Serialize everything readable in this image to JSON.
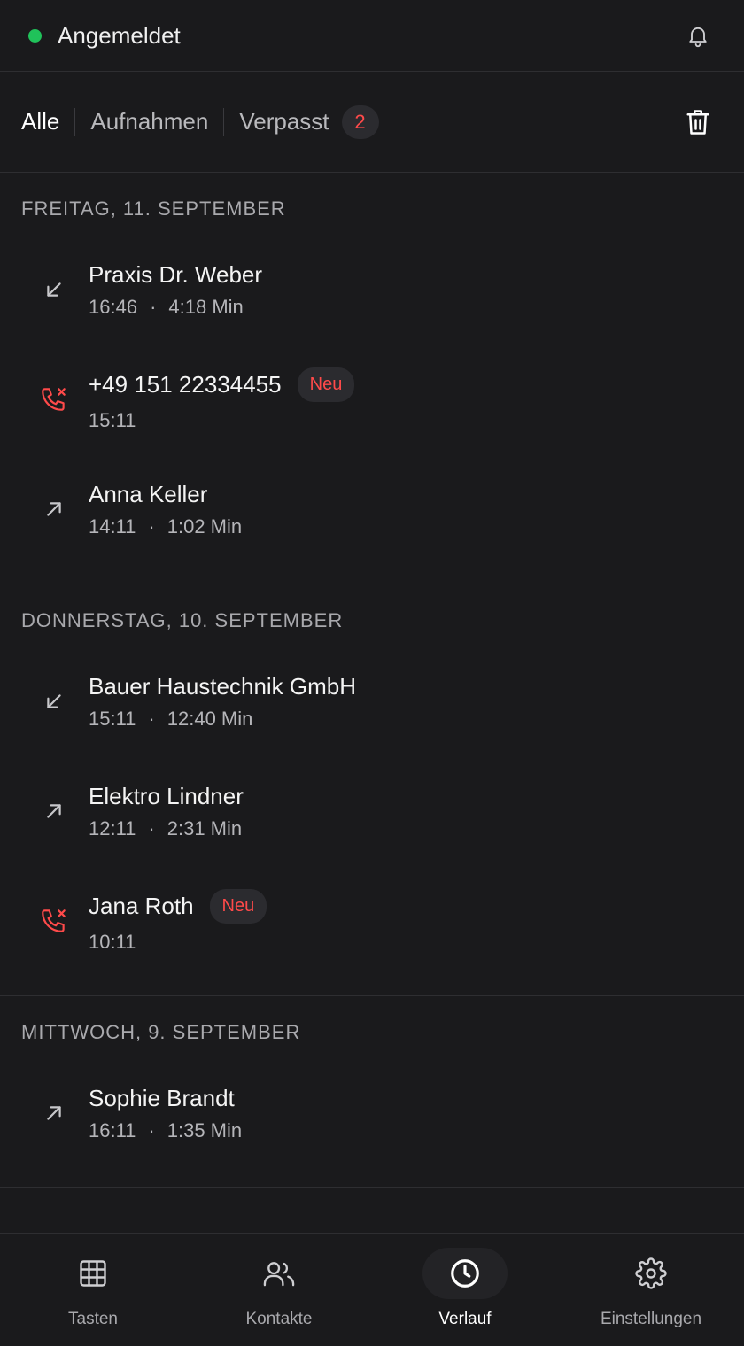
{
  "status": {
    "label": "Angemeldet",
    "dot_color": "#20c25a",
    "bell_icon": "bell-icon"
  },
  "tabs": {
    "items": [
      {
        "label": "Alle",
        "active": true
      },
      {
        "label": "Aufnahmen",
        "active": false
      },
      {
        "label": "Verpasst",
        "active": false
      }
    ],
    "missed_count": "2",
    "trash_icon": "trash-icon"
  },
  "sections": [
    {
      "title": "FREITAG, 11. SEPTEMBER",
      "calls": [
        {
          "type": "incoming",
          "name": "Praxis Dr. Weber",
          "time": "16:46",
          "separator": "·",
          "duration": "4:18 Min"
        },
        {
          "type": "missed",
          "name": "+49 151 22334455",
          "badge": "Neu",
          "time": "15:11"
        },
        {
          "type": "outgoing",
          "name": "Anna Keller",
          "time": "14:11",
          "separator": "·",
          "duration": "1:02 Min"
        }
      ]
    },
    {
      "title": "DONNERSTAG, 10. SEPTEMBER",
      "calls": [
        {
          "type": "incoming",
          "name": "Bauer Haustechnik GmbH",
          "time": "15:11",
          "separator": "·",
          "duration": "12:40 Min"
        },
        {
          "type": "outgoing",
          "name": "Elektro Lindner",
          "time": "12:11",
          "separator": "·",
          "duration": "2:31 Min"
        },
        {
          "type": "missed",
          "name": "Jana Roth",
          "badge": "Neu",
          "time": "10:11"
        }
      ]
    },
    {
      "title": "MITTWOCH, 9. SEPTEMBER",
      "calls": [
        {
          "type": "outgoing",
          "name": "Sophie Brandt",
          "time": "16:11",
          "separator": "·",
          "duration": "1:35 Min"
        }
      ]
    }
  ],
  "nav": {
    "items": [
      {
        "label": "Tasten",
        "icon": "keypad-icon",
        "active": false
      },
      {
        "label": "Kontakte",
        "icon": "contacts-icon",
        "active": false
      },
      {
        "label": "Verlauf",
        "icon": "clock-icon",
        "active": true
      },
      {
        "label": "Einstellungen",
        "icon": "gear-icon",
        "active": false
      }
    ]
  },
  "colors": {
    "background": "#1a1a1c",
    "missed": "#ff4a4a",
    "online": "#20c25a"
  }
}
